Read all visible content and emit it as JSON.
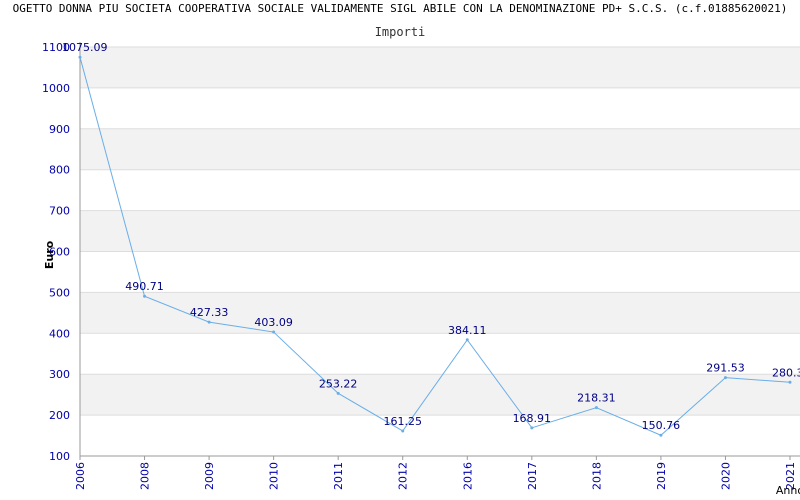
{
  "chart_data": {
    "type": "line",
    "title": "OGETTO DONNA PIU SOCIETA COOPERATIVA SOCIALE VALIDAMENTE SIGL ABILE CON LA DENOMINAZIONE PD+ S.C.S. (c.f.01885620021)",
    "subtitle": "Importi",
    "xlabel": "Anno",
    "ylabel": "Euro",
    "ylim": [
      100,
      1100
    ],
    "yticks": [
      100,
      200,
      300,
      400,
      500,
      600,
      700,
      800,
      900,
      1000,
      1100
    ],
    "grid": true,
    "categories": [
      "2006",
      "2008",
      "2009",
      "2010",
      "2011",
      "2012",
      "2016",
      "2017",
      "2018",
      "2019",
      "2020",
      "2021"
    ],
    "values": [
      1075.09,
      490.71,
      427.33,
      403.09,
      253.22,
      161.25,
      384.11,
      168.91,
      218.31,
      150.76,
      291.53,
      280.3
    ],
    "labels": [
      "1075.09",
      "490.71",
      "427.33",
      "403.09",
      "253.22",
      "161.25",
      "384.11",
      "168.91",
      "218.31",
      "150.76",
      "291.53",
      "280.3"
    ],
    "colors": {
      "line": "#6aaee8",
      "axis_text": "#0000aa",
      "label": "#000080",
      "band": "#f2f2f2"
    }
  }
}
